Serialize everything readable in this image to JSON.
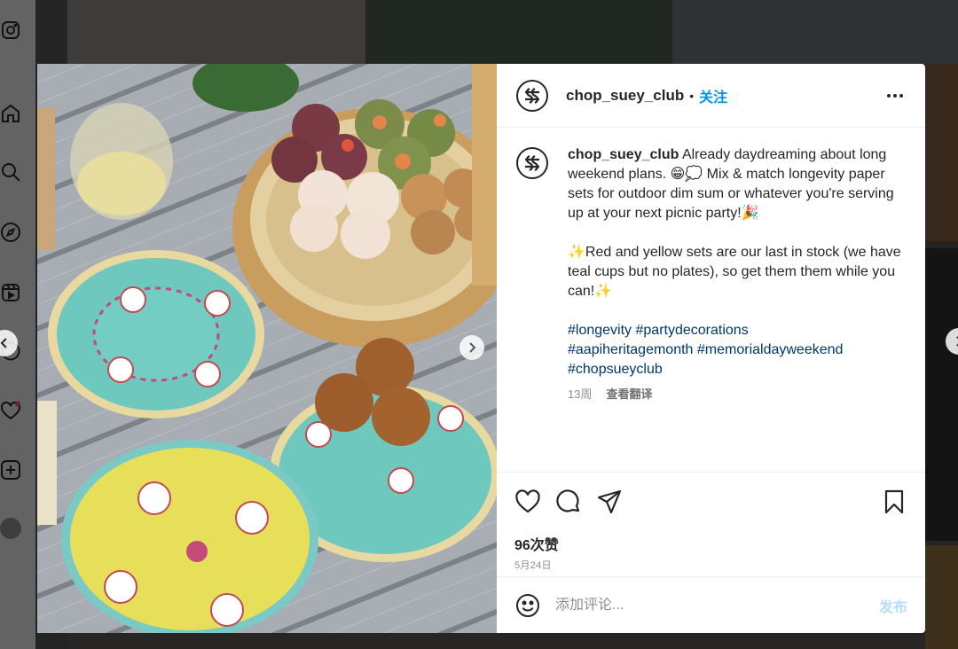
{
  "colors": {
    "accent": "#0095f6",
    "hashtag": "#00376b",
    "muted": "#8e8e8e",
    "text": "#262626",
    "notification": "#ed4956"
  },
  "nav": {
    "icons": [
      "instagram-icon",
      "home-icon",
      "search-icon",
      "explore-icon",
      "reels-icon",
      "messenger-icon",
      "heart-icon",
      "create-icon",
      "profile-avatar"
    ]
  },
  "post": {
    "username": "chop_suey_club",
    "separator": "•",
    "follow_label": "关注",
    "more_icon": "more-horizontal-icon",
    "caption": {
      "username": "chop_suey_club",
      "text_1": " Already daydreaming about long weekend plans. 😁💭 Mix & match longevity paper sets for outdoor dim sum or whatever you're serving up at your next picnic party!🎉",
      "text_2": "✨Red and yellow sets are our last in stock (we have teal cups but no plates), so get them them while you can!✨",
      "hashtags": [
        "#longevity",
        "#partydecorations",
        "#aapiheritagemonth",
        "#memorialdayweekend",
        "#chopsueyclub"
      ]
    },
    "age": "13周",
    "see_translation": "查看翻译",
    "likes": "96次赞",
    "date": "5月24日",
    "comment_placeholder": "添加评论...",
    "post_button": "发布"
  }
}
